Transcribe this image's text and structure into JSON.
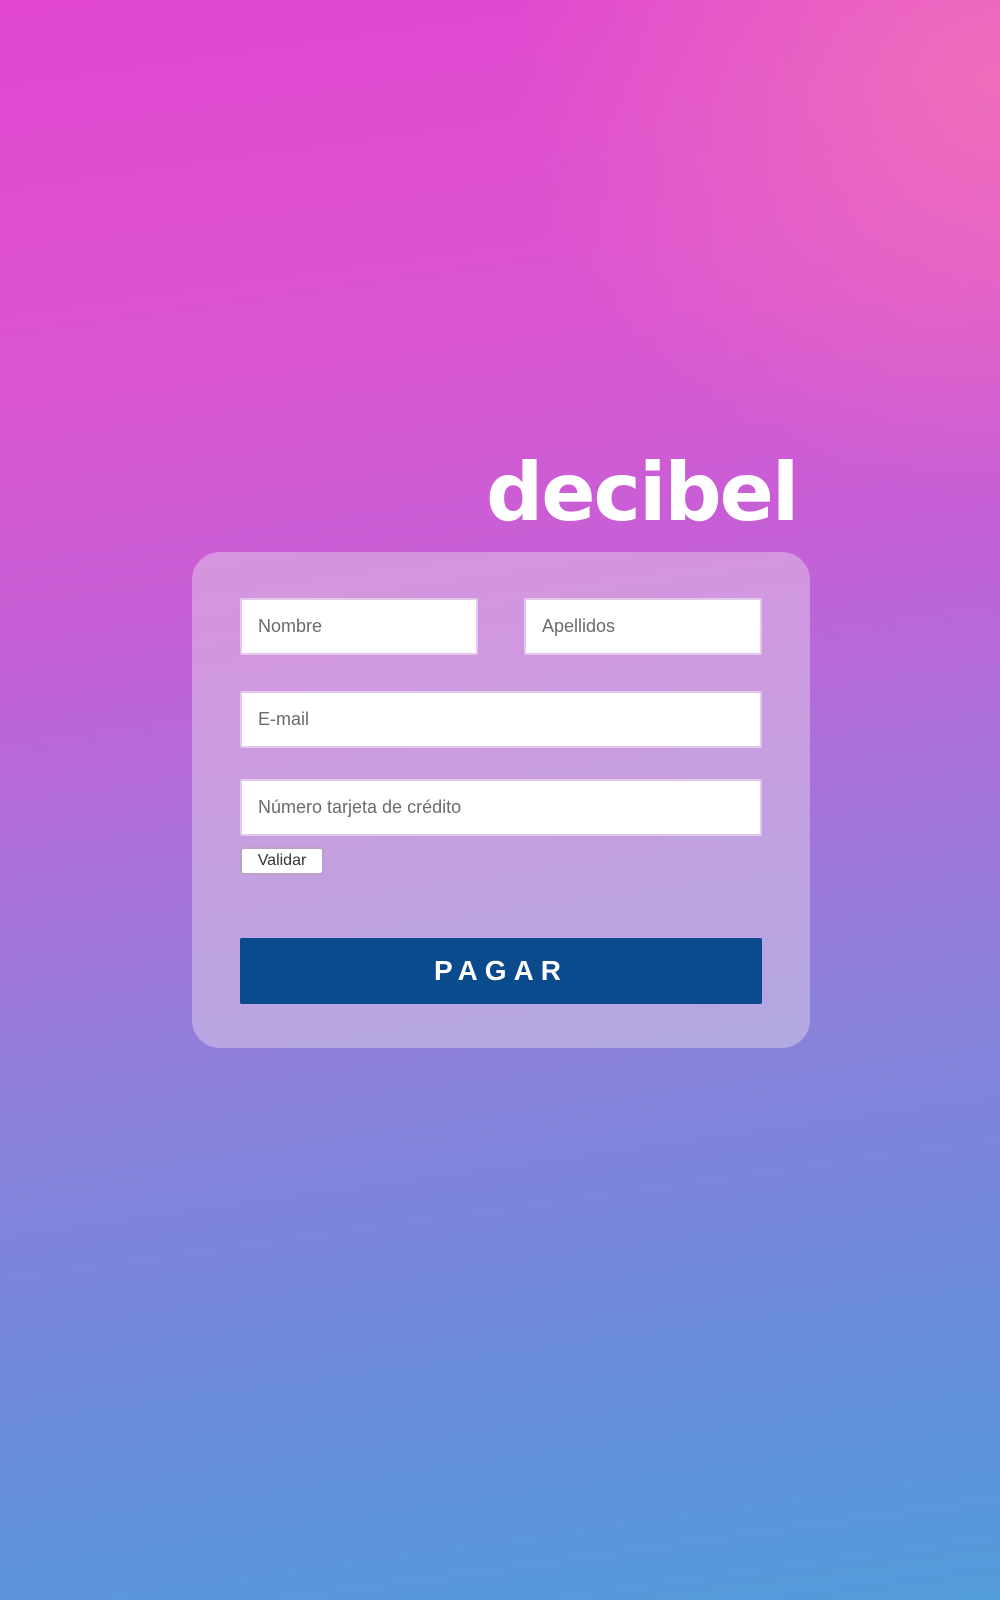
{
  "brand": {
    "logo_text": "decibel"
  },
  "form": {
    "nombre_placeholder": "Nombre",
    "apellidos_placeholder": "Apellidos",
    "email_placeholder": "E-mail",
    "tarjeta_placeholder": "Número tarjeta de crédito",
    "validar_label": "Validar",
    "pagar_label": "PAGAR"
  },
  "colors": {
    "background_top": "#e046cf",
    "background_bottom": "#529cd9",
    "pay_button": "#0b4a8c",
    "logo_text": "#ffffff"
  }
}
